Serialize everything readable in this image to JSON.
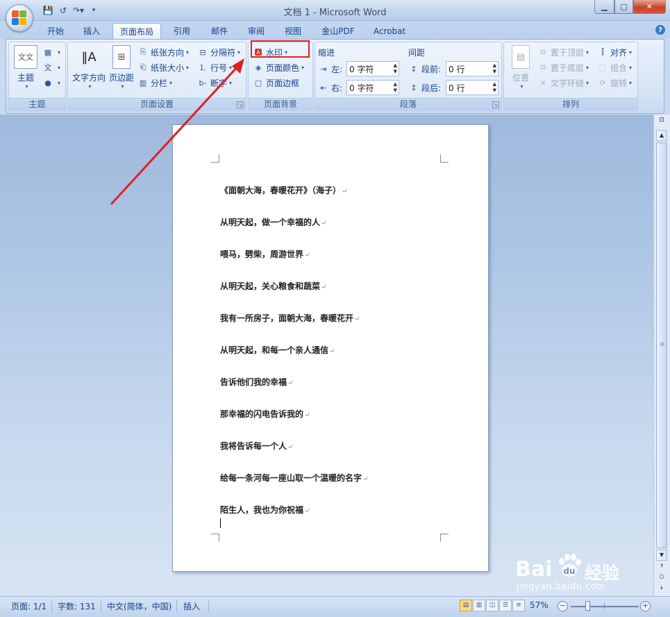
{
  "window": {
    "title": "文档 1 - Microsoft Word",
    "controls": [
      "minimize",
      "maximize",
      "close"
    ]
  },
  "tabs": [
    {
      "label": "开始"
    },
    {
      "label": "插入"
    },
    {
      "label": "页面布局",
      "active": true
    },
    {
      "label": "引用"
    },
    {
      "label": "邮件"
    },
    {
      "label": "审阅"
    },
    {
      "label": "视图"
    },
    {
      "label": "金山PDF"
    },
    {
      "label": "Acrobat"
    }
  ],
  "ribbon": {
    "theme_group": {
      "label": "主题",
      "theme_button": "主题"
    },
    "page_setup": {
      "label": "页面设置",
      "text_direction": "文字方向",
      "margins": "页边距",
      "orientation": "纸张方向",
      "size": "纸张大小",
      "columns": "分栏",
      "breaks": "分隔符",
      "line_numbers": "行号",
      "hyphenation": "断字"
    },
    "page_background": {
      "label": "页面背景",
      "watermark": "水印",
      "page_color": "页面颜色",
      "page_borders": "页面边框"
    },
    "paragraph": {
      "label": "段落",
      "indent_title": "缩进",
      "indent_left_label": "左:",
      "indent_left_value": "0 字符",
      "indent_right_label": "右:",
      "indent_right_value": "0 字符",
      "spacing_title": "间距",
      "spacing_before_label": "段前:",
      "spacing_before_value": "0 行",
      "spacing_after_label": "段后:",
      "spacing_after_value": "0 行"
    },
    "arrange": {
      "label": "排列",
      "position": "位置",
      "bring_front": "置于顶层",
      "send_back": "置于底层",
      "text_wrap": "文字环绕",
      "align": "对齐",
      "group": "组合",
      "rotate": "旋转"
    }
  },
  "document": {
    "lines": [
      "《面朝大海，春暖花开》（海子）",
      "从明天起，做一个幸福的人",
      "喂马，劈柴，周游世界",
      "从明天起，关心粮食和蔬菜",
      "我有一所房子，面朝大海，春暖花开",
      "从明天起，和每一个亲人通信",
      "告诉他们我的幸福",
      "那幸福的闪电告诉我的",
      "我将告诉每一个人",
      "给每一条河每一座山取一个温暖的名字",
      "陌生人，我也为你祝福"
    ],
    "paragraph_mark": "↵"
  },
  "statusbar": {
    "page": "页面: 1/1",
    "words": "字数: 131",
    "language": "中文(简体，中国)",
    "mode": "插入",
    "zoom": "57%"
  },
  "watermark_logo": {
    "brand": "Bai",
    "brand_cn": "经验",
    "url": "jingyan.baidu.com"
  },
  "colors": {
    "highlight_box": "#e02020",
    "arrow": "#e02020",
    "ribbon_text": "#15428b"
  }
}
